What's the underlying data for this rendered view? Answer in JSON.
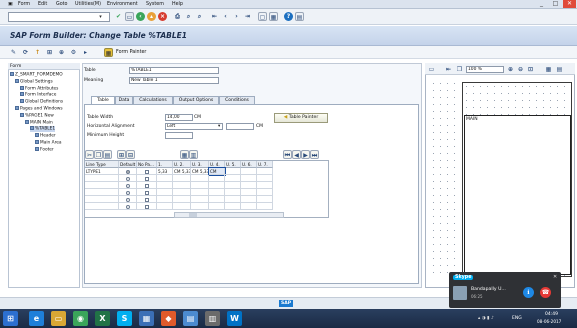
{
  "menubar": {
    "items": [
      "Form",
      "Edit",
      "Goto",
      "Utilities(M)",
      "Environment",
      "System",
      "Help"
    ],
    "window_buttons": [
      "_",
      "□",
      "✕"
    ]
  },
  "toolbar": {
    "command_field": "",
    "icons": [
      "enter-icon",
      "save-icon",
      "back-icon",
      "exit-icon",
      "cancel-icon",
      "print-icon",
      "find-icon",
      "find-next-icon",
      "first-page-icon",
      "prev-page-icon",
      "next-page-icon",
      "last-page-icon",
      "new-session-icon",
      "shortcut-icon",
      "help-icon",
      "customize-icon"
    ]
  },
  "title": "SAP Form Builder: Change Table %TABLE1",
  "app_toolbar": {
    "form_painter_label": "Form Painter"
  },
  "tree": {
    "header": "Form",
    "items": [
      {
        "label": "Z_SMART_FORMDEMO",
        "indent": 0,
        "selected": false
      },
      {
        "label": "Global Settings",
        "indent": 1,
        "selected": false
      },
      {
        "label": "Form Attributes",
        "indent": 2,
        "selected": false
      },
      {
        "label": "Form Interface",
        "indent": 2,
        "selected": false
      },
      {
        "label": "Global Definitions",
        "indent": 2,
        "selected": false
      },
      {
        "label": "Pages and Windows",
        "indent": 1,
        "selected": false
      },
      {
        "label": "%PAGE1 New",
        "indent": 2,
        "selected": false
      },
      {
        "label": "MAIN Main",
        "indent": 3,
        "selected": false
      },
      {
        "label": "%TABLE1",
        "indent": 4,
        "selected": true
      },
      {
        "label": "Header",
        "indent": 5,
        "selected": false
      },
      {
        "label": "Main Area",
        "indent": 5,
        "selected": false
      },
      {
        "label": "Footer",
        "indent": 5,
        "selected": false
      }
    ]
  },
  "form": {
    "table_label": "Table",
    "table_value": "%TABLE1",
    "meaning_label": "Meaning",
    "meaning_value": "New Table 1",
    "tabs": [
      "Table",
      "Data",
      "Calculations",
      "Output Options",
      "Conditions"
    ],
    "active_tab": 0,
    "table_width_label": "Table Width",
    "table_width_value": "14,00",
    "table_width_unit": "CM",
    "horizontal_alignment_label": "Horizontal Alignment",
    "horizontal_alignment_value": "Left",
    "horizontal_alignment_unit": "CM",
    "minimum_height_label": "Minimum Height",
    "minimum_height_value": "",
    "table_painter_label": "Table Painter"
  },
  "grid": {
    "columns": [
      "Line Type",
      "Default",
      "No Pa...",
      "1.",
      "U. 2.",
      "U. 3.",
      "U. 4.",
      "U. 5.",
      "U. 6.",
      "U. 7."
    ],
    "rows": [
      [
        "LTYPE1",
        "radio-on",
        "check",
        "5,33",
        "CM 5,33",
        "CM 5,33",
        "CM",
        "",
        "",
        ""
      ],
      [
        "",
        "radio",
        "check",
        "",
        "",
        "",
        "",
        "",
        "",
        ""
      ],
      [
        "",
        "radio",
        "check",
        "",
        "",
        "",
        "",
        "",
        "",
        ""
      ],
      [
        "",
        "radio",
        "check",
        "",
        "",
        "",
        "",
        "",
        "",
        ""
      ],
      [
        "",
        "radio",
        "check",
        "",
        "",
        "",
        "",
        "",
        "",
        ""
      ],
      [
        "",
        "radio",
        "check",
        "",
        "",
        "",
        "",
        "",
        "",
        ""
      ]
    ]
  },
  "painter": {
    "zoom": "100 %",
    "window_label": "MAIN"
  },
  "status": {
    "logo": "SAP"
  },
  "skype": {
    "brand": "Skype",
    "caller": "Bandapally U...",
    "call_time": "06:25"
  },
  "taskbar": {
    "lang": "ENG",
    "time": "04:49",
    "date": "08-06-2017"
  },
  "colors": {
    "title_bar": "#c4d3ea",
    "taskbar": "#1a2a44",
    "skype_accept": "#1e88e5",
    "skype_decline": "#e53935",
    "toolbar_green": "#3aa55a",
    "toolbar_red": "#d63c2f"
  }
}
